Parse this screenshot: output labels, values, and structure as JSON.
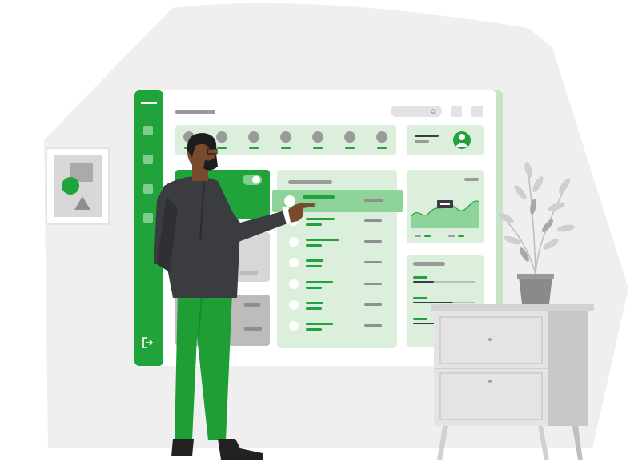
{
  "illustration": {
    "subject": "dashboard-illustration",
    "colors": {
      "backdrop": "#efefef",
      "accent": "#1fa33a",
      "accent_dark": "#168a2e",
      "panel_light": "#dcefdc",
      "panel_mid": "#c6e4c7",
      "gray_light": "#d7d7d7",
      "gray_mid": "#bcbcbc",
      "suit": "#3a3c3f",
      "pants": "#1f9e36",
      "skin": "#7a4a2e",
      "hair": "#1d1d1d"
    },
    "icons": [
      "menu-icon",
      "search-icon",
      "logout-icon",
      "user-avatar-icon",
      "area-chart-icon",
      "plant-icon"
    ]
  }
}
